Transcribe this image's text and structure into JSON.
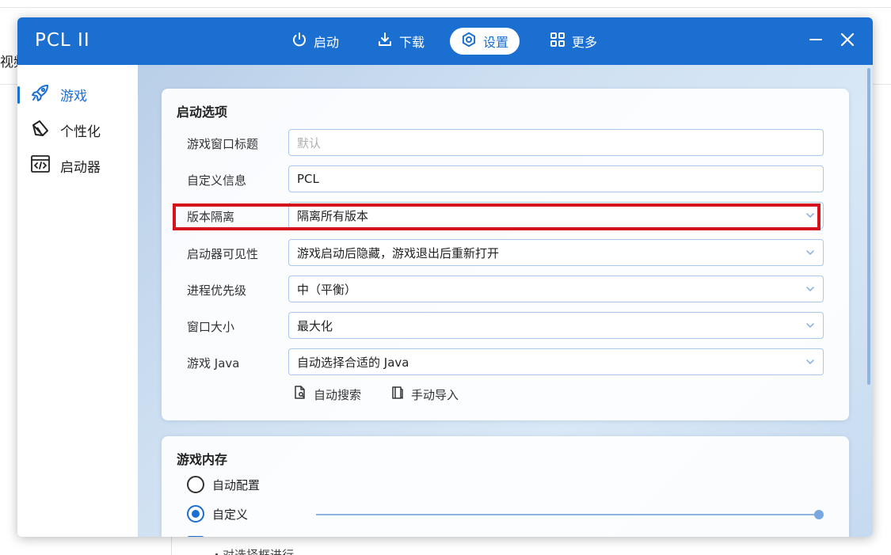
{
  "background": {
    "left_text": "视频",
    "bottom_text": "・对选择框进行"
  },
  "window": {
    "title": "PCL II",
    "nav": [
      {
        "label": "启动",
        "icon": "power-icon",
        "active": false
      },
      {
        "label": "下载",
        "icon": "download-icon",
        "active": false
      },
      {
        "label": "设置",
        "icon": "settings-icon",
        "active": true
      },
      {
        "label": "更多",
        "icon": "grid-icon",
        "active": false
      }
    ],
    "controls": {
      "minimize": "minimize-icon",
      "close": "close-icon"
    }
  },
  "sidebar": {
    "items": [
      {
        "label": "游戏",
        "icon": "rocket-icon",
        "active": true
      },
      {
        "label": "个性化",
        "icon": "brush-icon",
        "active": false
      },
      {
        "label": "启动器",
        "icon": "code-window-icon",
        "active": false
      }
    ]
  },
  "launch_options": {
    "title": "启动选项",
    "rows": [
      {
        "label": "游戏窗口标题",
        "value": "",
        "placeholder": "默认",
        "type": "text"
      },
      {
        "label": "自定义信息",
        "value": "PCL",
        "type": "text"
      },
      {
        "label": "版本隔离",
        "value": "隔离所有版本",
        "type": "select",
        "highlighted": true
      },
      {
        "label": "启动器可见性",
        "value": "游戏启动后隐藏，游戏退出后重新打开",
        "type": "select"
      },
      {
        "label": "进程优先级",
        "value": "中（平衡）",
        "type": "select"
      },
      {
        "label": "窗口大小",
        "value": "最大化",
        "type": "select"
      },
      {
        "label": "游戏 Java",
        "value": "自动选择合适的 Java",
        "type": "select"
      }
    ],
    "buttons": {
      "auto_search": "自动搜索",
      "manual_import": "手动导入"
    }
  },
  "memory": {
    "title": "游戏内存",
    "options": [
      {
        "label": "自动配置",
        "selected": false
      },
      {
        "label": "自定义",
        "selected": true
      }
    ],
    "slider_fraction": 1.0
  },
  "colors": {
    "accent": "#1a6fd1",
    "highlight": "#d4141c"
  }
}
